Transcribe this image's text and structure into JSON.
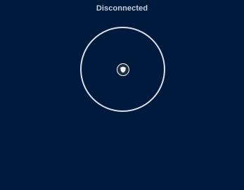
{
  "status": {
    "label": "Disconnected"
  },
  "connection_control": {
    "icon": "shield-icon",
    "ring_color": "#d8dde6",
    "background_color": "#001a3d"
  }
}
